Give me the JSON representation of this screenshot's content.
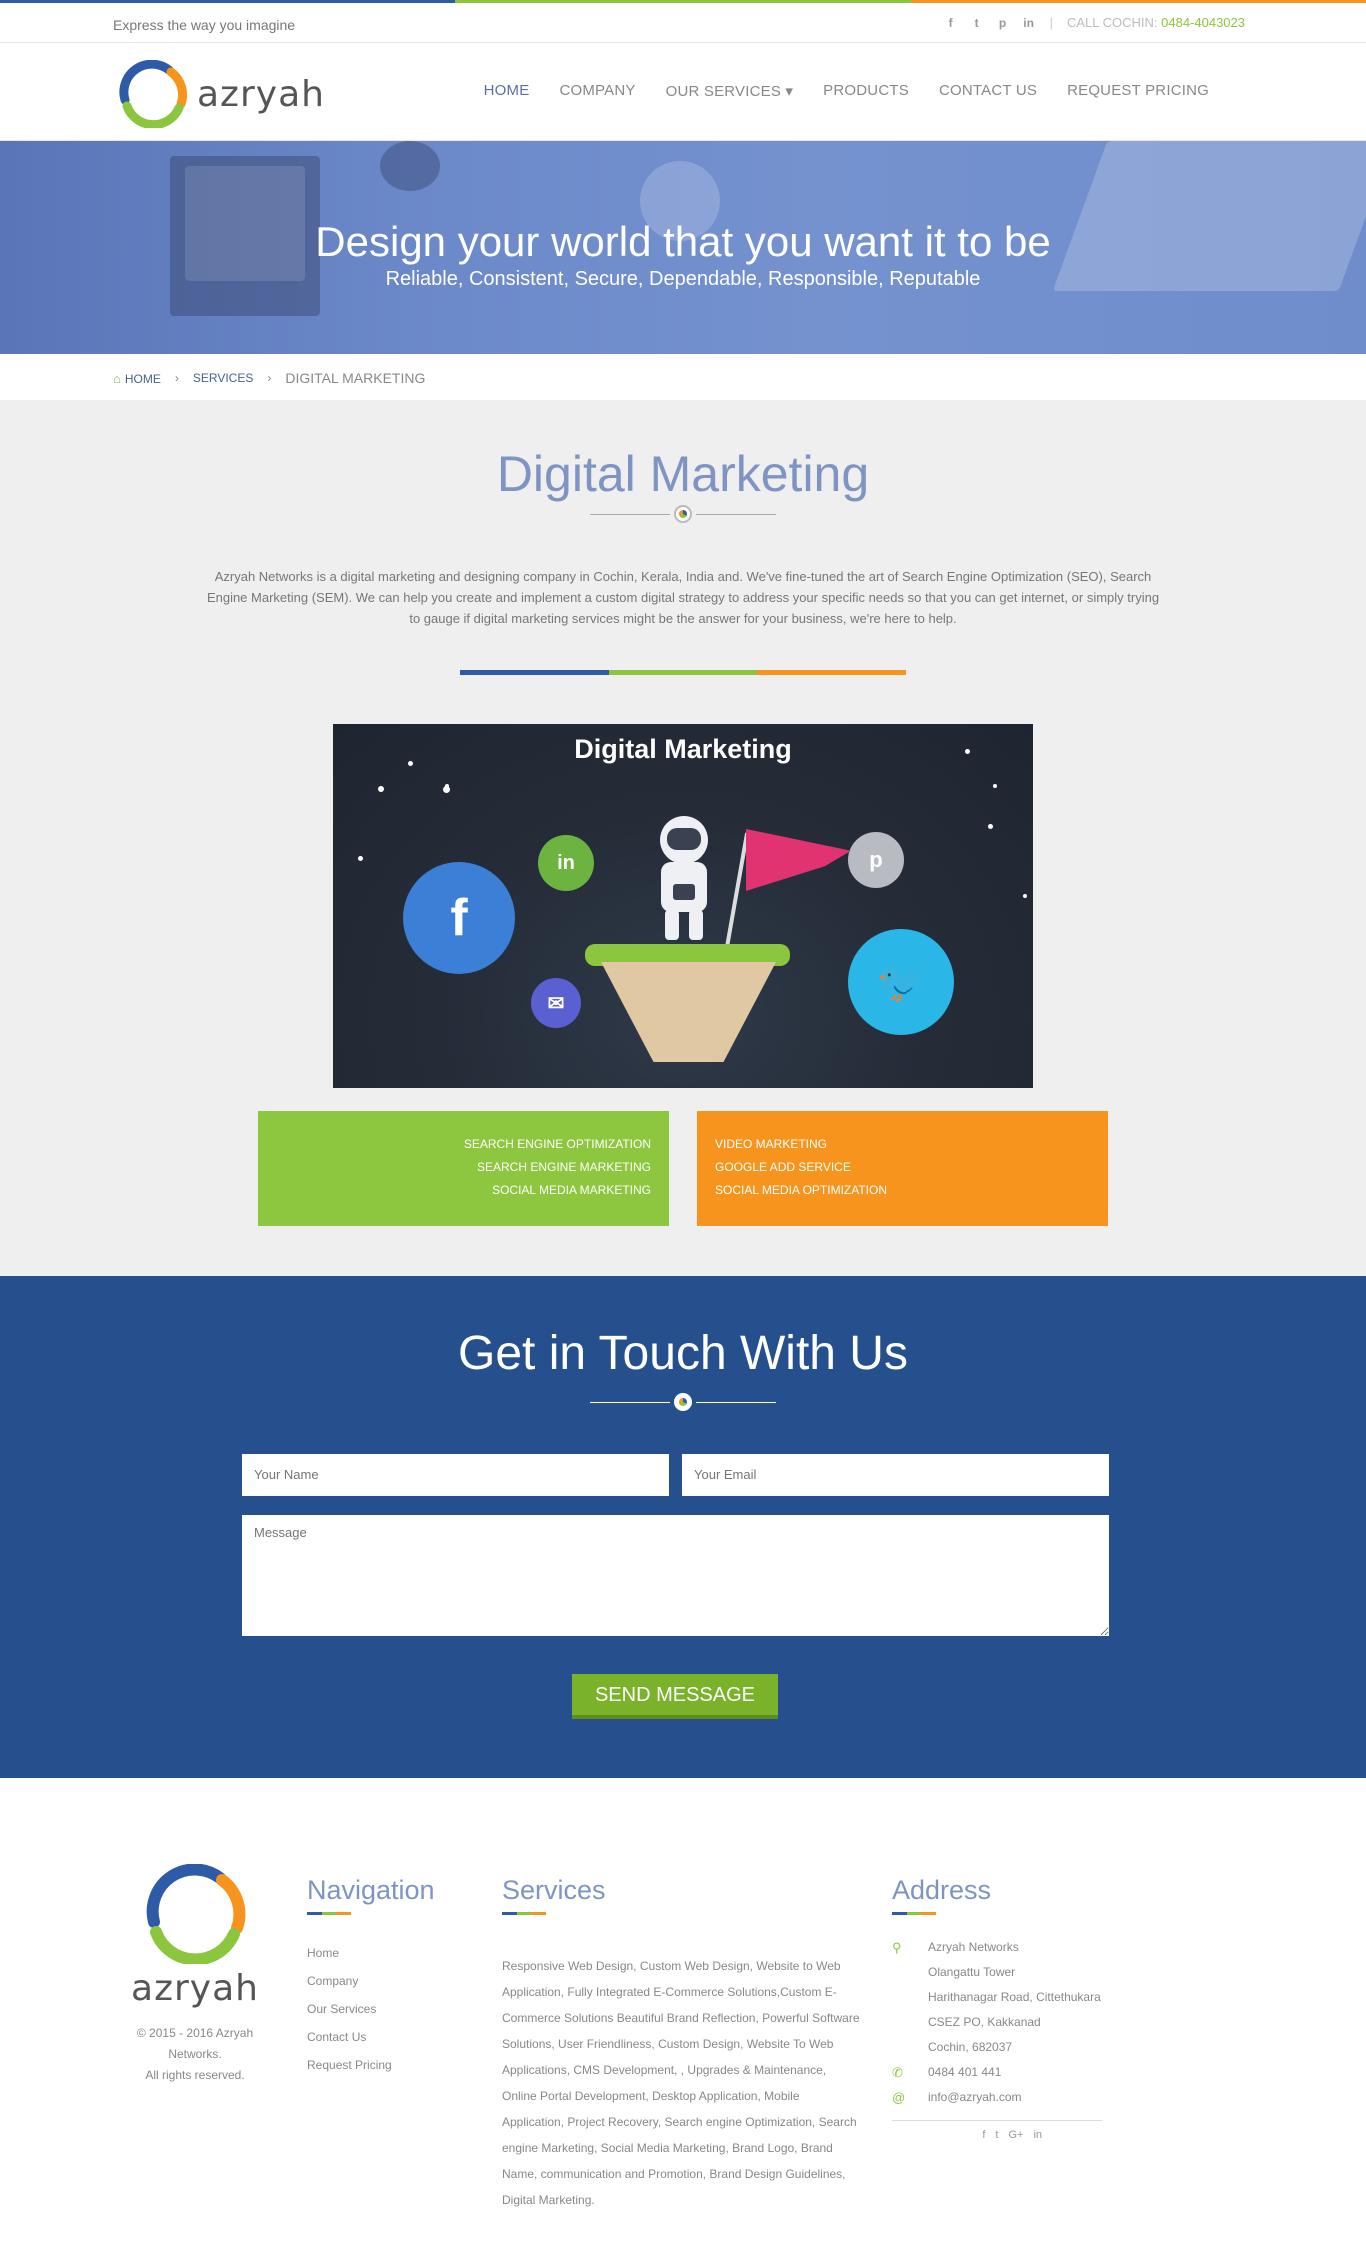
{
  "brand": {
    "name": "azryah",
    "colors": {
      "blue": "#2e5ba8",
      "green": "#8cc63f",
      "orange": "#f7941d",
      "navy": "#26508d",
      "title": "#7e95c4"
    }
  },
  "utility": {
    "tagline": "Express the way you imagine",
    "social": [
      {
        "icon": "facebook-icon",
        "glyph": "f"
      },
      {
        "icon": "twitter-icon",
        "glyph": "t"
      },
      {
        "icon": "pinterest-icon",
        "glyph": "p"
      },
      {
        "icon": "linkedin-icon",
        "glyph": "in"
      }
    ],
    "call_label": "CALL COCHIN:",
    "call_number": "0484-4043023"
  },
  "nav": {
    "items": [
      {
        "label": "HOME",
        "active": true
      },
      {
        "label": "COMPANY"
      },
      {
        "label": "OUR SERVICES ▾"
      },
      {
        "label": "PRODUCTS"
      },
      {
        "label": "CONTACT US"
      },
      {
        "label": "REQUEST PRICING"
      }
    ]
  },
  "hero": {
    "title": "Design your world that you want it to be",
    "subtitle": "Reliable, Consistent, Secure, Dependable, Responsible, Reputable"
  },
  "breadcrumb": {
    "home": "HOME",
    "services": "SERVICES",
    "current": "DIGITAL MARKETING"
  },
  "main": {
    "title": "Digital Marketing",
    "intro": "Azryah Networks is a digital marketing and designing company in Cochin, Kerala, India and. We've fine-tuned the art of Search Engine Optimization (SEO), Search Engine Marketing (SEM). We can help you create and implement a custom digital strategy to address your specific needs so that you can get internet, or simply trying to gauge if digital marketing services might be the answer for your business, we're here to help.",
    "image_title": "Digital Marketing",
    "services_left": [
      "SEARCH ENGINE OPTIMIZATION",
      "SEARCH ENGINE MARKETING",
      "SOCIAL MEDIA MARKETING"
    ],
    "services_right": [
      "VIDEO MARKETING",
      "GOOGLE ADD SERVICE",
      "SOCIAL MEDIA OPTIMIZATION"
    ]
  },
  "contact": {
    "title": "Get in Touch With Us",
    "name_placeholder": "Your Name",
    "email_placeholder": "Your Email",
    "message_placeholder": "Message",
    "send_label": "SEND MESSAGE"
  },
  "footer": {
    "copyright_line1": "© 2015 - 2016 Azryah",
    "copyright_line2": "Networks.",
    "copyright_line3": "All rights reserved.",
    "nav_title": "Navigation",
    "nav_links": [
      "Home",
      "Company",
      "Our Services",
      "Contact Us",
      "Request Pricing"
    ],
    "services_title": "Services",
    "services_text": "Responsive Web Design, Custom Web Design, Website to Web Application, Fully Integrated E-Commerce Solutions,Custom E-Commerce Solutions Beautiful Brand Reflection, Powerful Software Solutions, User Friendliness, Custom Design, Website To Web Applications, CMS Development, , Upgrades & Maintenance, Online Portal Development, Desktop Application, Mobile Application, Project Recovery, Search engine Optimization, Search engine Marketing, Social Media Marketing, Brand Logo, Brand Name, communication and Promotion, Brand Design Guidelines, Digital Marketing.",
    "address_title": "Address",
    "address_lines": [
      "Azryah Networks",
      "Olangattu Tower",
      "Harithanagar Road, Cittethukara",
      "CSEZ PO, Kakkanad",
      "Cochin, 682037"
    ],
    "phone": "0484 401 441",
    "email": "info@azryah.com",
    "social": [
      "f",
      "t",
      "G+",
      "in"
    ]
  }
}
